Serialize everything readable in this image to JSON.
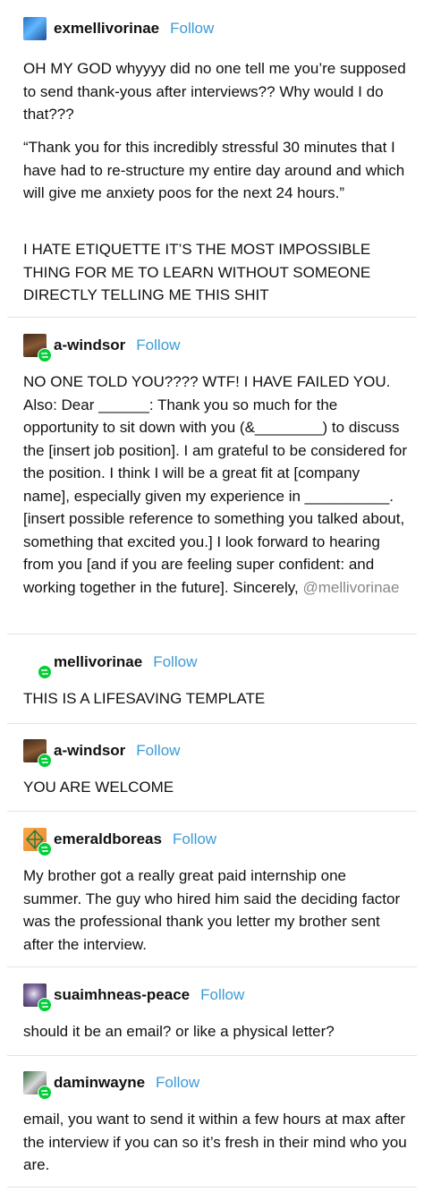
{
  "follow_label": "Follow",
  "posts": [
    {
      "username": "exmellivorinae",
      "avatar_icon": "blue-flame-avatar",
      "reblog": false,
      "paragraphs": [
        "OH MY GOD whyyyy did no one tell me you’re supposed to send thank-yous after interviews?? Why would I do that???",
        "“Thank you for this incredibly stressful 30 minutes that I have had to re-structure my entire day around and which will give me anxiety poos for the next 24 hours.”",
        "I HATE ETIQUETTE IT’S THE MOST IMPOSSIBLE THING FOR ME TO LEARN WITHOUT SOMEONE DIRECTLY TELLING ME THIS SHIT"
      ]
    },
    {
      "username": "a-windsor",
      "avatar_icon": "portrait-avatar",
      "reblog": true,
      "paragraphs": [
        "NO ONE TOLD YOU???? WTF! I HAVE FAILED YOU. Also:  Dear ______:  Thank you so much for the opportunity to sit down with you (&________) to discuss the [insert job position]. I am grateful to be considered for the position.  I think I will be a great fit at [company name], especially given my experience in __________. [insert possible reference to something you talked about, something that excited you.] I look forward to hearing from you [and if you are feeling super confident: and working together in the future].  Sincerely,"
      ],
      "mention": "@mellivorinae"
    },
    {
      "username": "mellivorinae",
      "avatar_icon": "blank-avatar",
      "reblog": true,
      "paragraphs": [
        "THIS IS A LIFESAVING TEMPLATE"
      ]
    },
    {
      "username": "a-windsor",
      "avatar_icon": "portrait-avatar",
      "reblog": true,
      "paragraphs": [
        "YOU ARE WELCOME"
      ]
    },
    {
      "username": "emeraldboreas",
      "avatar_icon": "diamond-avatar",
      "reblog": true,
      "paragraphs": [
        "My brother got a really great paid internship one summer. The guy who hired him said the deciding factor was the professional thank you letter my brother sent after the interview."
      ]
    },
    {
      "username": "suaimhneas-peace",
      "avatar_icon": "moon-avatar",
      "reblog": true,
      "paragraphs": [
        "should it be an email? or like a physical letter?"
      ]
    },
    {
      "username": "daminwayne",
      "avatar_icon": "character-avatar",
      "reblog": true,
      "paragraphs": [
        "email, you want to send it within a few hours at max after the interview if you can so it’s fresh in their mind who you are."
      ]
    }
  ],
  "colors": {
    "follow": "#3b9bd6",
    "reblog_badge": "#00cf35",
    "divider": "#e3e3e3",
    "mention": "#888888"
  }
}
